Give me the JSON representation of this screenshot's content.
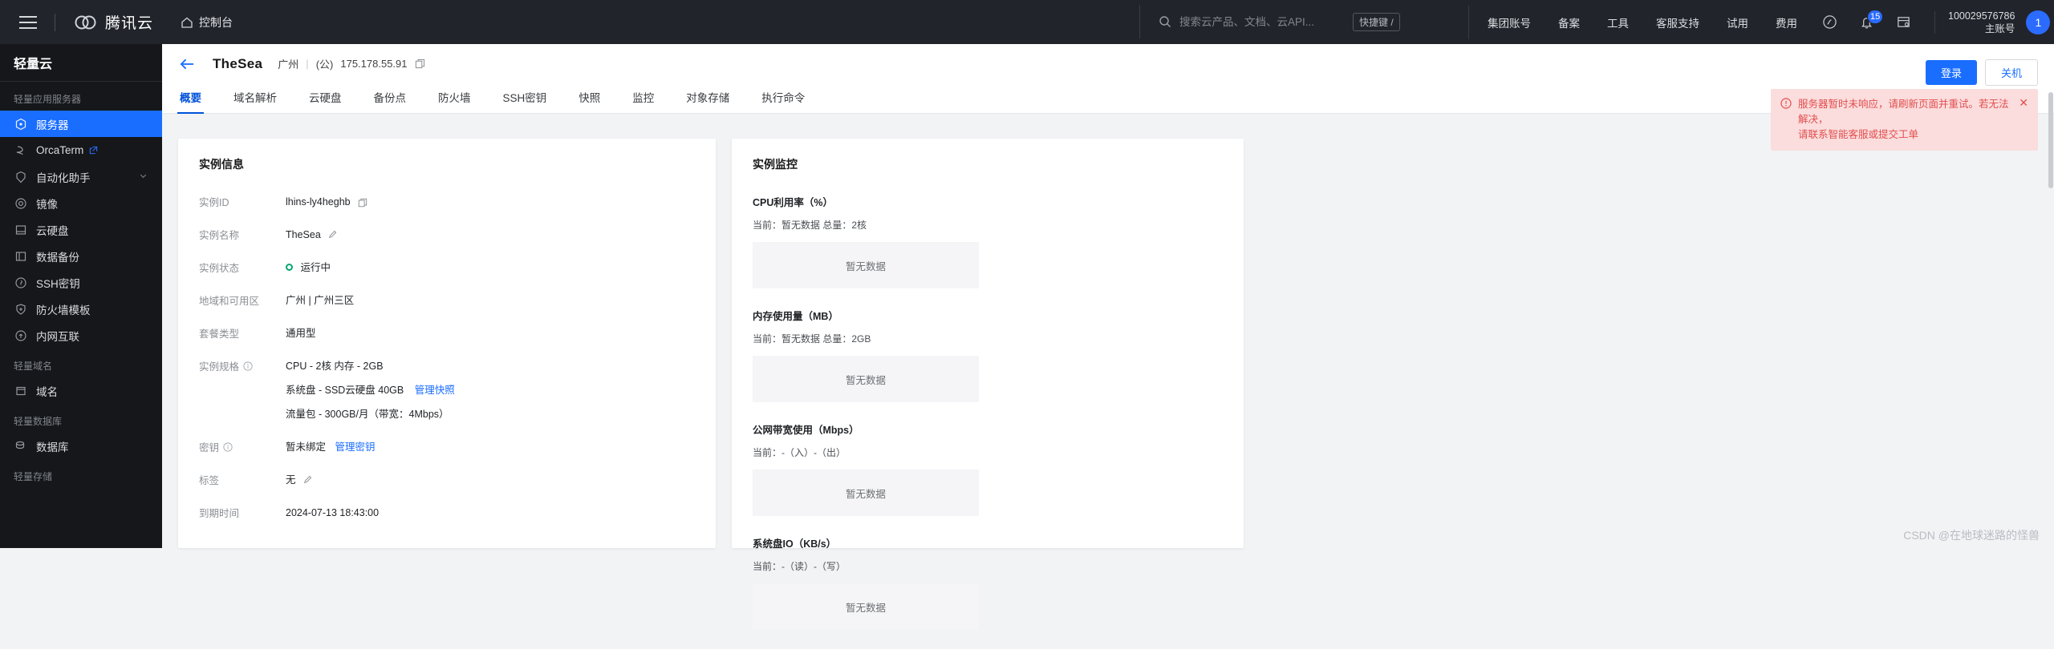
{
  "topbar": {
    "menu_icon": "hamburger-icon",
    "brand": "腾讯云",
    "console": "控制台",
    "search_placeholder": "搜索云产品、文档、云API...",
    "search_value": "",
    "shortcut_label": "快捷键 /",
    "nav_items": [
      "集团账号",
      "备案",
      "工具",
      "客服支持",
      "试用",
      "费用"
    ],
    "notification_count": "15",
    "account_id": "100029576786",
    "account_type": "主账号",
    "avatar_label": "1"
  },
  "sidebar": {
    "title": "轻量云",
    "groups": [
      {
        "label": "轻量应用服务器",
        "items": [
          {
            "label": "服务器",
            "icon": "server-icon",
            "active": true
          },
          {
            "label": "OrcaTerm",
            "icon": "terminal-icon",
            "external": true
          },
          {
            "label": "自动化助手",
            "icon": "automation-icon",
            "expandable": true
          },
          {
            "label": "镜像",
            "icon": "image-icon"
          },
          {
            "label": "云硬盘",
            "icon": "disk-icon"
          },
          {
            "label": "数据备份",
            "icon": "backup-icon"
          },
          {
            "label": "SSH密钥",
            "icon": "key-icon"
          },
          {
            "label": "防火墙模板",
            "icon": "shield-icon"
          },
          {
            "label": "内网互联",
            "icon": "network-icon"
          }
        ]
      },
      {
        "label": "轻量域名",
        "items": [
          {
            "label": "域名",
            "icon": "domain-icon"
          }
        ]
      },
      {
        "label": "轻量数据库",
        "items": [
          {
            "label": "数据库",
            "icon": "database-icon"
          }
        ]
      },
      {
        "label": "轻量存储",
        "items": []
      }
    ]
  },
  "page": {
    "back_icon": "back-arrow-icon",
    "instance_name": "TheSea",
    "region": "广州",
    "divider": "|",
    "ip_type": "(公)",
    "ip": "175.178.55.91",
    "copy_icon": "copy-icon",
    "tabs": [
      "概要",
      "域名解析",
      "云硬盘",
      "备份点",
      "防火墙",
      "SSH密钥",
      "快照",
      "监控",
      "对象存储",
      "执行命令"
    ],
    "active_tab_index": 0,
    "primary_button": "登录",
    "secondary_button": "关机"
  },
  "alert": {
    "icon": "warning-circle-icon",
    "line1": "服务器暂时未响应，请刷新页面并重试。若无法解决，",
    "line2": "请联系智能客服或提交工单",
    "close_icon": "close-icon",
    "color": "#e34d4d",
    "background": "#fbdddd"
  },
  "instance_info": {
    "title": "实例信息",
    "rows": [
      {
        "label": "实例ID",
        "value": "lhins-ly4heghb",
        "copy": true
      },
      {
        "label": "实例名称",
        "value": "TheSea",
        "edit": true
      },
      {
        "label": "实例状态",
        "value": "运行中",
        "status": "running",
        "status_color": "#00a870"
      },
      {
        "label": "地域和可用区",
        "value": "广州  |  广州三区"
      },
      {
        "label": "套餐类型",
        "value": "通用型"
      },
      {
        "label": "实例规格",
        "info": true,
        "lines": [
          {
            "text": "CPU - 2核 内存 - 2GB"
          },
          {
            "text": "系统盘 - SSD云硬盘 40GB",
            "link": "管理快照"
          },
          {
            "text": "流量包 - 300GB/月（带宽：4Mbps）"
          }
        ]
      },
      {
        "label": "密钥",
        "info": true,
        "value": "暂未绑定",
        "link": "管理密钥"
      },
      {
        "label": "标签",
        "value": "无",
        "edit": true
      },
      {
        "label": "到期时间",
        "value": "2024-07-13 18:43:00"
      }
    ]
  },
  "instance_monitor": {
    "title": "实例监控",
    "empty_text": "暂无数据",
    "metrics": [
      {
        "title": "CPU利用率（%）",
        "sub": "当前：暂无数据 总量：2核"
      },
      {
        "title": "内存使用量（MB）",
        "sub": "当前：暂无数据 总量：2GB"
      },
      {
        "title": "公网带宽使用（Mbps）",
        "sub": "当前：-（入）-（出）"
      },
      {
        "title": "系统盘IO（KB/s）",
        "sub": "当前：-（读）-（写）"
      }
    ]
  },
  "watermark": "CSDN @在地球迷路的怪兽",
  "colors": {
    "accent": "#1a6eff",
    "tab_active": "#0052d9",
    "success": "#00a870",
    "danger": "#e34d4d"
  }
}
